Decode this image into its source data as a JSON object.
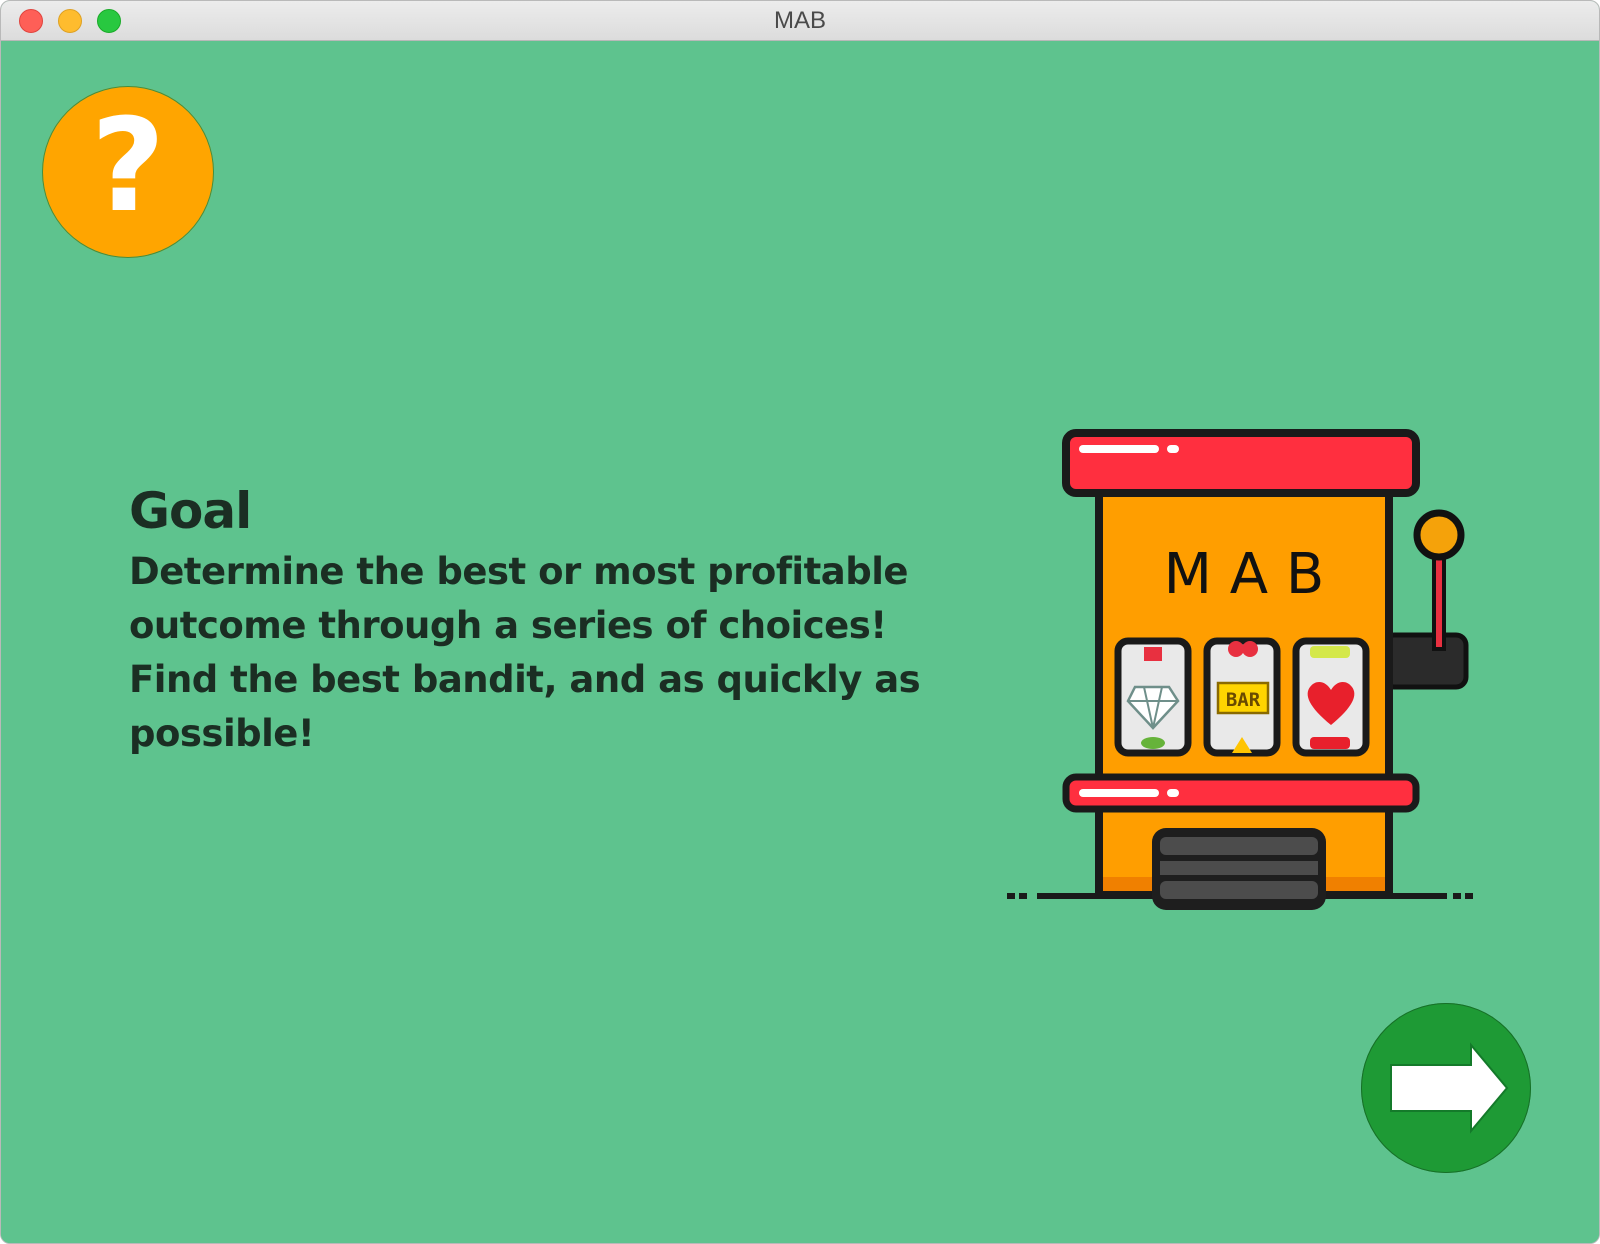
{
  "window": {
    "title": "MAB"
  },
  "help_button": {
    "glyph": "?"
  },
  "goal": {
    "heading": "Goal",
    "lines": [
      "Determine the best or most profitable",
      "outcome through a series of choices!",
      "Find the best bandit, and as quickly as",
      "possible!"
    ]
  },
  "slot_machine": {
    "sign": "M A B",
    "reels": [
      "diamond",
      "BAR",
      "heart"
    ],
    "bar_label": "BAR"
  },
  "next_button": {
    "icon": "arrow-right-icon"
  },
  "colors": {
    "background": "#5ec38e",
    "help_button": "#ffa500",
    "next_button": "#1e9a35",
    "text": "#1b2e23"
  }
}
